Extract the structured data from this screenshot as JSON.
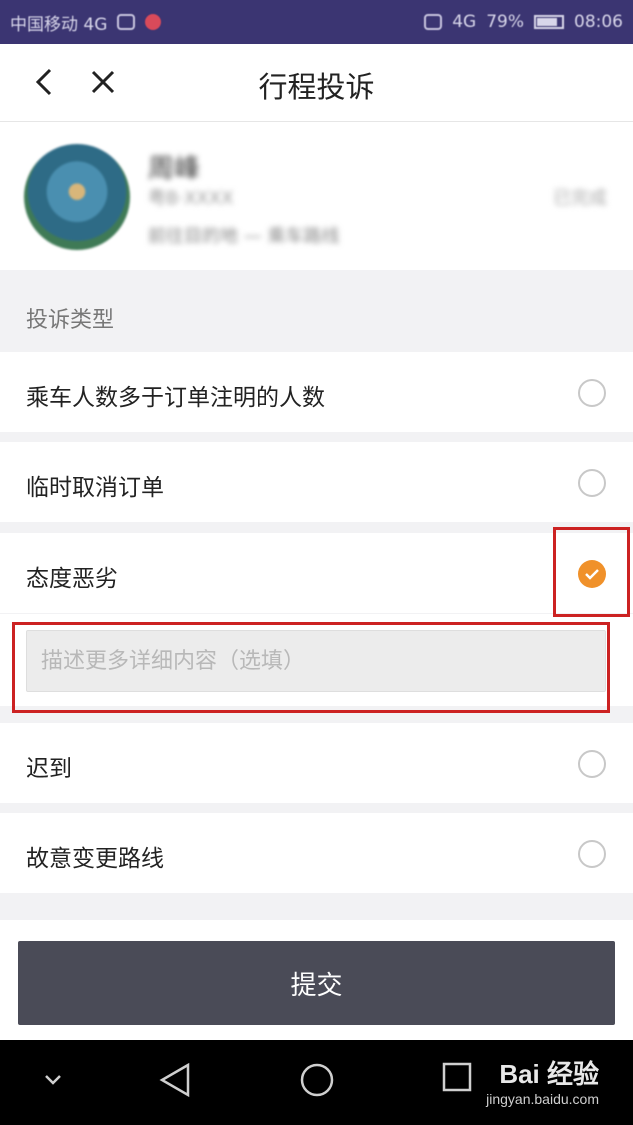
{
  "status_bar": {
    "carrier": "中国移动 4G",
    "signal": "4G",
    "battery": "79%",
    "time": "08:06"
  },
  "header": {
    "title": "行程投诉"
  },
  "driver": {
    "name": "周峰",
    "plate": "粤B·XXXX",
    "status": "已完成",
    "route": "前往目的地 — 乘车路线"
  },
  "complaint": {
    "section_label": "投诉类型",
    "options": [
      {
        "label": "乘车人数多于订单注明的人数",
        "checked": false
      },
      {
        "label": "临时取消订单",
        "checked": false
      },
      {
        "label": "态度恶劣",
        "checked": true
      },
      {
        "label": "迟到",
        "checked": false
      },
      {
        "label": "故意变更路线",
        "checked": false
      }
    ],
    "detail_placeholder": "描述更多详细内容（选填）"
  },
  "submit_label": "提交",
  "watermark": {
    "brand": "Bai 经验",
    "url": "jingyan.baidu.com"
  },
  "colors": {
    "accent": "#f0912a",
    "status_bar": "#3b3572",
    "submit": "#4a4b57",
    "highlight": "#cc2222"
  }
}
